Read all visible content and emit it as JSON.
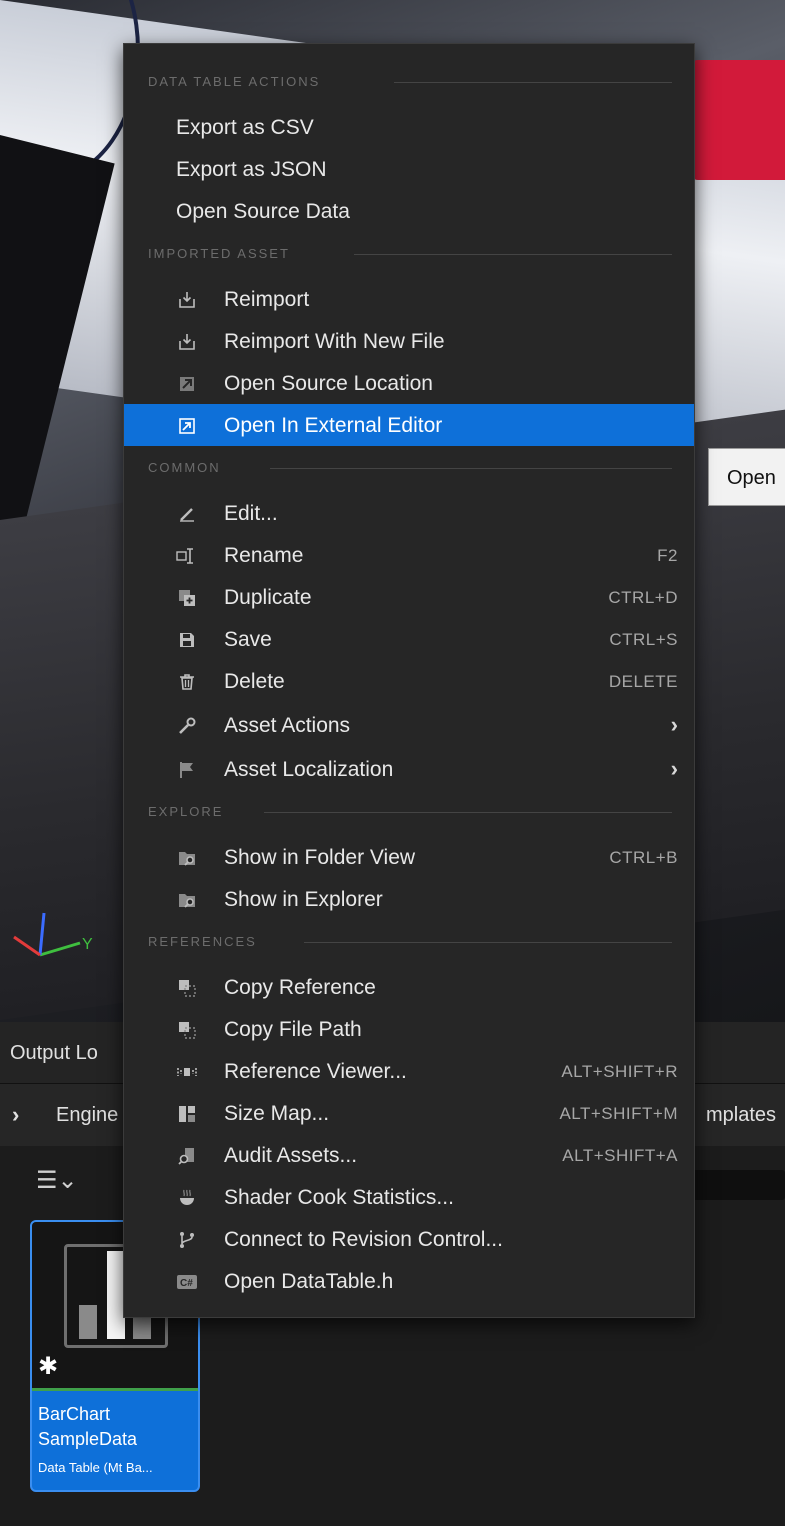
{
  "tooltip": {
    "text": "Open"
  },
  "bottom": {
    "output_tab_label": "Output Lo",
    "breadcrumb_engine": "Engine",
    "breadcrumb_templates": "mplates",
    "asset": {
      "name": "BarChart SampleData",
      "type": "Data Table (Mt Ba..."
    }
  },
  "menu": {
    "sections": {
      "data_table_actions": "DATA TABLE ACTIONS",
      "imported_asset": "IMPORTED ASSET",
      "common": "COMMON",
      "explore": "EXPLORE",
      "references": "REFERENCES"
    },
    "items": {
      "export_csv": {
        "label": "Export as CSV"
      },
      "export_json": {
        "label": "Export as JSON"
      },
      "open_source_data": {
        "label": "Open Source Data"
      },
      "reimport": {
        "label": "Reimport",
        "icon": "reimport-icon"
      },
      "reimport_new": {
        "label": "Reimport With New File",
        "icon": "reimport-icon"
      },
      "open_source_location": {
        "label": "Open Source Location",
        "icon": "open-location-icon"
      },
      "open_external_editor": {
        "label": "Open In External Editor",
        "icon": "external-editor-icon",
        "highlighted": true
      },
      "edit": {
        "label": "Edit...",
        "icon": "pencil-icon"
      },
      "rename": {
        "label": "Rename",
        "shortcut": "F2",
        "icon": "rename-icon"
      },
      "duplicate": {
        "label": "Duplicate",
        "shortcut": "CTRL+D",
        "icon": "duplicate-icon"
      },
      "save": {
        "label": "Save",
        "shortcut": "CTRL+S",
        "icon": "save-icon"
      },
      "delete": {
        "label": "Delete",
        "shortcut": "DELETE",
        "icon": "trash-icon"
      },
      "asset_actions": {
        "label": "Asset Actions",
        "icon": "wrench-icon",
        "submenu": true
      },
      "asset_localization": {
        "label": "Asset Localization",
        "icon": "flag-icon",
        "submenu": true
      },
      "show_folder_view": {
        "label": "Show in Folder View",
        "shortcut": "CTRL+B",
        "icon": "folder-search-icon"
      },
      "show_explorer": {
        "label": "Show in Explorer",
        "icon": "folder-search-icon"
      },
      "copy_reference": {
        "label": "Copy Reference",
        "icon": "copy-icon"
      },
      "copy_file_path": {
        "label": "Copy File Path",
        "icon": "copy-icon"
      },
      "reference_viewer": {
        "label": "Reference Viewer...",
        "shortcut": "ALT+SHIFT+R",
        "icon": "reference-viewer-icon"
      },
      "size_map": {
        "label": "Size Map...",
        "shortcut": "ALT+SHIFT+M",
        "icon": "size-map-icon"
      },
      "audit_assets": {
        "label": "Audit Assets...",
        "shortcut": "ALT+SHIFT+A",
        "icon": "audit-icon"
      },
      "shader_cook": {
        "label": "Shader Cook Statistics...",
        "icon": "shader-cook-icon"
      },
      "revision_control": {
        "label": "Connect to Revision Control...",
        "icon": "branch-icon"
      },
      "open_datatable_h": {
        "label": "Open DataTable.h",
        "icon": "cpp-file-icon"
      }
    }
  },
  "colors": {
    "menu_bg": "#262626",
    "highlight": "#0e70d9",
    "section_header": "#6c6c6c",
    "text": "#e8e8e8",
    "shortcut": "#a7a7a7"
  }
}
